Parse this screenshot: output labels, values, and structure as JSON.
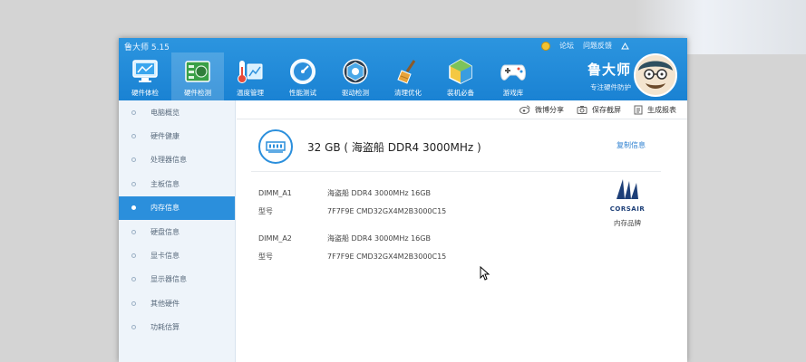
{
  "window": {
    "title": "鲁大师 5.15"
  },
  "header_links": {
    "forum": "论坛",
    "feedback": "问题反馈"
  },
  "toolbar": [
    {
      "label": "硬件体检",
      "icon": "monitor-icon"
    },
    {
      "label": "硬件检测",
      "icon": "circuit-board-icon"
    },
    {
      "label": "温度管理",
      "icon": "thermometer-icon"
    },
    {
      "label": "性能测试",
      "icon": "speedometer-icon"
    },
    {
      "label": "驱动检测",
      "icon": "driver-gear-icon"
    },
    {
      "label": "清理优化",
      "icon": "broom-icon"
    },
    {
      "label": "装机必备",
      "icon": "cube-icon"
    },
    {
      "label": "游戏库",
      "icon": "gamepad-icon"
    }
  ],
  "brand": {
    "name": "鲁大师",
    "slogan": "专注硬件防护"
  },
  "sidebar": {
    "items": [
      {
        "label": "电脑概览"
      },
      {
        "label": "硬件健康"
      },
      {
        "label": "处理器信息"
      },
      {
        "label": "主板信息"
      },
      {
        "label": "内存信息"
      },
      {
        "label": "硬盘信息"
      },
      {
        "label": "显卡信息"
      },
      {
        "label": "显示器信息"
      },
      {
        "label": "其他硬件"
      },
      {
        "label": "功耗估算"
      }
    ],
    "active_index": 4
  },
  "actions": {
    "share": "微博分享",
    "screenshot": "保存截屏",
    "report": "生成报表"
  },
  "memory": {
    "summary": "32 GB ( 海盗船 DDR4 3000MHz )",
    "copy_label": "复制信息",
    "slots": [
      {
        "slot": "DIMM_A1",
        "desc": "海盗船 DDR4 3000MHz 16GB",
        "model_key": "型号",
        "model": "7F7F9E CMD32GX4M2B3000C15"
      },
      {
        "slot": "DIMM_A2",
        "desc": "海盗船 DDR4 3000MHz 16GB",
        "model_key": "型号",
        "model": "7F7F9E CMD32GX4M2B3000C15"
      }
    ],
    "brand_logo_text": "CORSAIR",
    "brand_caption": "内存品牌"
  },
  "colors": {
    "accent": "#2b8fdc",
    "header": "#1f88d8",
    "sidebar_bg": "#eef4fa"
  }
}
